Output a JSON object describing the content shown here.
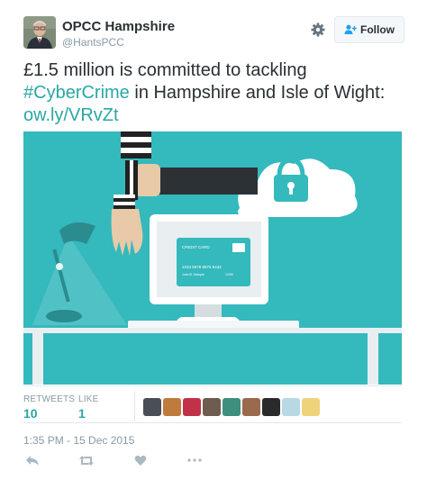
{
  "account": {
    "name": "OPCC Hampshire",
    "handle": "@HantsPCC"
  },
  "follow_button": {
    "label": "Follow"
  },
  "tweet": {
    "line1": "£1.5 million is committed to tackling",
    "hashtag": "#CyberCrime",
    "line2_rest": " in Hampshire and Isle of Wight:",
    "link": "ow.ly/VRvZt"
  },
  "media": {
    "card_title": "CREDIT CARD",
    "card_number": "1234 5678 9876 5432",
    "card_holder": "John B. Sample",
    "card_expiry": "12/99"
  },
  "stats": {
    "retweets_label": "RETWEETS",
    "retweets_value": "10",
    "likes_label": "LIKE",
    "likes_value": "1"
  },
  "timestamp": "1:35 PM - 15 Dec 2015",
  "colors": {
    "accent": "#2aa7a4",
    "media_bg": "#34b9bd",
    "follow_icon": "#1da1f2"
  },
  "icons": [
    "gear-icon",
    "follow-person-icon",
    "reply-icon",
    "retweet-icon",
    "like-icon",
    "more-icon",
    "padlock-icon"
  ]
}
